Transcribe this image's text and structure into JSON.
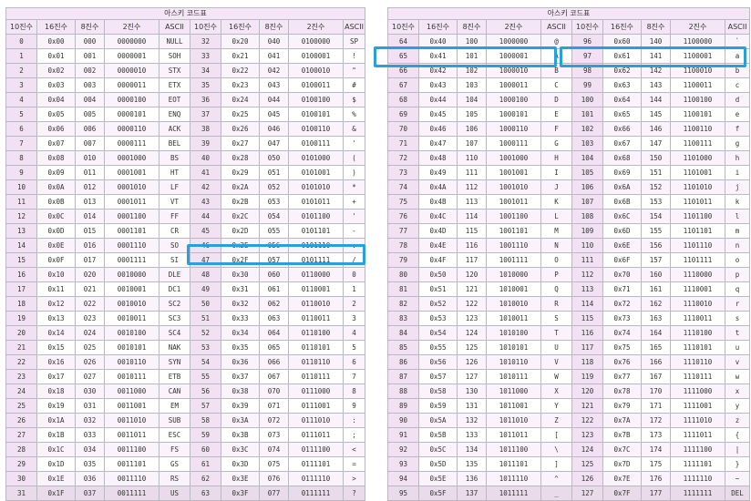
{
  "title": "아스키 코드표",
  "headers": [
    "10진수",
    "16진수",
    "8진수",
    "2진수",
    "ASCII",
    "10진수",
    "16진수",
    "8진수",
    "2진수",
    "ASCII"
  ],
  "left_rows": [
    [
      "0",
      "0x00",
      "000",
      "0000000",
      "NULL",
      "32",
      "0x20",
      "040",
      "0100000",
      "SP"
    ],
    [
      "1",
      "0x01",
      "001",
      "0000001",
      "SOH",
      "33",
      "0x21",
      "041",
      "0100001",
      "!"
    ],
    [
      "2",
      "0x02",
      "002",
      "0000010",
      "STX",
      "34",
      "0x22",
      "042",
      "0100010",
      "\""
    ],
    [
      "3",
      "0x03",
      "003",
      "0000011",
      "ETX",
      "35",
      "0x23",
      "043",
      "0100011",
      "#"
    ],
    [
      "4",
      "0x04",
      "004",
      "0000100",
      "EOT",
      "36",
      "0x24",
      "044",
      "0100100",
      "$"
    ],
    [
      "5",
      "0x05",
      "005",
      "0000101",
      "ENQ",
      "37",
      "0x25",
      "045",
      "0100101",
      "%"
    ],
    [
      "6",
      "0x06",
      "006",
      "0000110",
      "ACK",
      "38",
      "0x26",
      "046",
      "0100110",
      "&"
    ],
    [
      "7",
      "0x07",
      "007",
      "0000111",
      "BEL",
      "39",
      "0x27",
      "047",
      "0100111",
      "'"
    ],
    [
      "8",
      "0x08",
      "010",
      "0001000",
      "BS",
      "40",
      "0x28",
      "050",
      "0101000",
      "("
    ],
    [
      "9",
      "0x09",
      "011",
      "0001001",
      "HT",
      "41",
      "0x29",
      "051",
      "0101001",
      ")"
    ],
    [
      "10",
      "0x0A",
      "012",
      "0001010",
      "LF",
      "42",
      "0x2A",
      "052",
      "0101010",
      "*"
    ],
    [
      "11",
      "0x0B",
      "013",
      "0001011",
      "VT",
      "43",
      "0x2B",
      "053",
      "0101011",
      "+"
    ],
    [
      "12",
      "0x0C",
      "014",
      "0001100",
      "FF",
      "44",
      "0x2C",
      "054",
      "0101100",
      "'"
    ],
    [
      "13",
      "0x0D",
      "015",
      "0001101",
      "CR",
      "45",
      "0x2D",
      "055",
      "0101101",
      "-"
    ],
    [
      "14",
      "0x0E",
      "016",
      "0001110",
      "SO",
      "46",
      "0x2E",
      "056",
      "0101110",
      "."
    ],
    [
      "15",
      "0x0F",
      "017",
      "0001111",
      "SI",
      "47",
      "0x2F",
      "057",
      "0101111",
      "/"
    ],
    [
      "16",
      "0x10",
      "020",
      "0010000",
      "DLE",
      "48",
      "0x30",
      "060",
      "0110000",
      "0"
    ],
    [
      "17",
      "0x11",
      "021",
      "0010001",
      "DC1",
      "49",
      "0x31",
      "061",
      "0110001",
      "1"
    ],
    [
      "18",
      "0x12",
      "022",
      "0010010",
      "SC2",
      "50",
      "0x32",
      "062",
      "0110010",
      "2"
    ],
    [
      "19",
      "0x13",
      "023",
      "0010011",
      "SC3",
      "51",
      "0x33",
      "063",
      "0110011",
      "3"
    ],
    [
      "20",
      "0x14",
      "024",
      "0010100",
      "SC4",
      "52",
      "0x34",
      "064",
      "0110100",
      "4"
    ],
    [
      "21",
      "0x15",
      "025",
      "0010101",
      "NAK",
      "53",
      "0x35",
      "065",
      "0110101",
      "5"
    ],
    [
      "22",
      "0x16",
      "026",
      "0010110",
      "SYN",
      "54",
      "0x36",
      "066",
      "0110110",
      "6"
    ],
    [
      "23",
      "0x17",
      "027",
      "0010111",
      "ETB",
      "55",
      "0x37",
      "067",
      "0110111",
      "7"
    ],
    [
      "24",
      "0x18",
      "030",
      "0011000",
      "CAN",
      "56",
      "0x38",
      "070",
      "0111000",
      "8"
    ],
    [
      "25",
      "0x19",
      "031",
      "0011001",
      "EM",
      "57",
      "0x39",
      "071",
      "0111001",
      "9"
    ],
    [
      "26",
      "0x1A",
      "032",
      "0011010",
      "SUB",
      "58",
      "0x3A",
      "072",
      "0111010",
      ":"
    ],
    [
      "27",
      "0x1B",
      "033",
      "0011011",
      "ESC",
      "59",
      "0x3B",
      "073",
      "0111011",
      ";"
    ],
    [
      "28",
      "0x1C",
      "034",
      "0011100",
      "FS",
      "60",
      "0x3C",
      "074",
      "0111100",
      "<"
    ],
    [
      "29",
      "0x1D",
      "035",
      "0011101",
      "GS",
      "61",
      "0x3D",
      "075",
      "0111101",
      "="
    ],
    [
      "30",
      "0x1E",
      "036",
      "0011110",
      "RS",
      "62",
      "0x3E",
      "076",
      "0111110",
      ">"
    ],
    [
      "31",
      "0x1F",
      "037",
      "0011111",
      "US",
      "63",
      "0x3F",
      "077",
      "0111111",
      "?"
    ]
  ],
  "right_rows": [
    [
      "64",
      "0x40",
      "100",
      "1000000",
      "@",
      "96",
      "0x60",
      "140",
      "1100000",
      "`"
    ],
    [
      "65",
      "0x41",
      "101",
      "1000001",
      "A",
      "97",
      "0x61",
      "141",
      "1100001",
      "a"
    ],
    [
      "66",
      "0x42",
      "102",
      "1000010",
      "B",
      "98",
      "0x62",
      "142",
      "1100010",
      "b"
    ],
    [
      "67",
      "0x43",
      "103",
      "1000011",
      "C",
      "99",
      "0x63",
      "143",
      "1100011",
      "c"
    ],
    [
      "68",
      "0x44",
      "104",
      "1000100",
      "D",
      "100",
      "0x64",
      "144",
      "1100100",
      "d"
    ],
    [
      "69",
      "0x45",
      "105",
      "1000101",
      "E",
      "101",
      "0x65",
      "145",
      "1100101",
      "e"
    ],
    [
      "70",
      "0x46",
      "106",
      "1000110",
      "F",
      "102",
      "0x66",
      "146",
      "1100110",
      "f"
    ],
    [
      "71",
      "0x47",
      "107",
      "1000111",
      "G",
      "103",
      "0x67",
      "147",
      "1100111",
      "g"
    ],
    [
      "72",
      "0x48",
      "110",
      "1001000",
      "H",
      "104",
      "0x68",
      "150",
      "1101000",
      "h"
    ],
    [
      "73",
      "0x49",
      "111",
      "1001001",
      "I",
      "105",
      "0x69",
      "151",
      "1101001",
      "i"
    ],
    [
      "74",
      "0x4A",
      "112",
      "1001010",
      "J",
      "106",
      "0x6A",
      "152",
      "1101010",
      "j"
    ],
    [
      "75",
      "0x4B",
      "113",
      "1001011",
      "K",
      "107",
      "0x6B",
      "153",
      "1101011",
      "k"
    ],
    [
      "76",
      "0x4C",
      "114",
      "1001100",
      "L",
      "108",
      "0x6C",
      "154",
      "1101100",
      "l"
    ],
    [
      "77",
      "0x4D",
      "115",
      "1001101",
      "M",
      "109",
      "0x6D",
      "155",
      "1101101",
      "m"
    ],
    [
      "78",
      "0x4E",
      "116",
      "1001110",
      "N",
      "110",
      "0x6E",
      "156",
      "1101110",
      "n"
    ],
    [
      "79",
      "0x4F",
      "117",
      "1001111",
      "O",
      "111",
      "0x6F",
      "157",
      "1101111",
      "o"
    ],
    [
      "80",
      "0x50",
      "120",
      "1010000",
      "P",
      "112",
      "0x70",
      "160",
      "1110000",
      "p"
    ],
    [
      "81",
      "0x51",
      "121",
      "1010001",
      "Q",
      "113",
      "0x71",
      "161",
      "1110001",
      "q"
    ],
    [
      "82",
      "0x52",
      "122",
      "1010010",
      "R",
      "114",
      "0x72",
      "162",
      "1110010",
      "r"
    ],
    [
      "83",
      "0x53",
      "123",
      "1010011",
      "S",
      "115",
      "0x73",
      "163",
      "1110011",
      "s"
    ],
    [
      "84",
      "0x54",
      "124",
      "1010100",
      "T",
      "116",
      "0x74",
      "164",
      "1110100",
      "t"
    ],
    [
      "85",
      "0x55",
      "125",
      "1010101",
      "U",
      "117",
      "0x75",
      "165",
      "1110101",
      "u"
    ],
    [
      "86",
      "0x56",
      "126",
      "1010110",
      "V",
      "118",
      "0x76",
      "166",
      "1110110",
      "v"
    ],
    [
      "87",
      "0x57",
      "127",
      "1010111",
      "W",
      "119",
      "0x77",
      "167",
      "1110111",
      "w"
    ],
    [
      "88",
      "0x58",
      "130",
      "1011000",
      "X",
      "120",
      "0x78",
      "170",
      "1111000",
      "x"
    ],
    [
      "89",
      "0x59",
      "131",
      "1011001",
      "Y",
      "121",
      "0x79",
      "171",
      "1111001",
      "y"
    ],
    [
      "90",
      "0x5A",
      "132",
      "1011010",
      "Z",
      "122",
      "0x7A",
      "172",
      "1111010",
      "z"
    ],
    [
      "91",
      "0x5B",
      "133",
      "1011011",
      "[",
      "123",
      "0x7B",
      "173",
      "1111011",
      "{"
    ],
    [
      "92",
      "0x5C",
      "134",
      "1011100",
      "\\",
      "124",
      "0x7C",
      "174",
      "1111100",
      "|"
    ],
    [
      "93",
      "0x5D",
      "135",
      "1011101",
      "]",
      "125",
      "0x7D",
      "175",
      "1111101",
      "}"
    ],
    [
      "94",
      "0x5E",
      "136",
      "1011110",
      "^",
      "126",
      "0x7E",
      "176",
      "1111110",
      "~"
    ],
    [
      "95",
      "0x5F",
      "137",
      "1011111",
      "_",
      "127",
      "0x7F",
      "177",
      "1111111",
      "DEL"
    ]
  ],
  "highlight_color": "#2a9fd9"
}
